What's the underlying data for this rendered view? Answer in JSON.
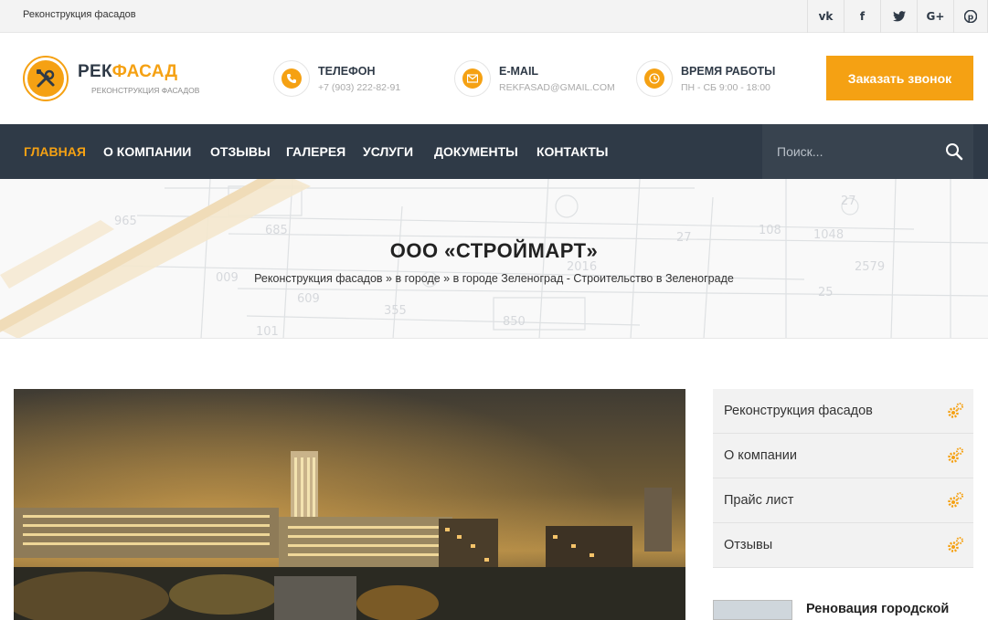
{
  "topbar": {
    "tagline": "Реконструкция фасадов",
    "social": [
      {
        "icon": "vk-icon",
        "glyph": "vk"
      },
      {
        "icon": "facebook-icon",
        "glyph": "f"
      },
      {
        "icon": "twitter-icon",
        "glyph": "t"
      },
      {
        "icon": "google-plus-icon",
        "glyph": "G+"
      },
      {
        "icon": "pinterest-icon",
        "glyph": "P"
      }
    ]
  },
  "header": {
    "logo_part1": "РЕК",
    "logo_part2": "ФАСАД",
    "logo_sub": "РЕКОНСТРУКЦИЯ ФАСАДОВ",
    "phone_title": "ТЕЛЕФОН",
    "phone_value": "+7 (903) 222-82-91",
    "email_title": "E-MAIL",
    "email_value": "REKFASAD@GMAIL.COM",
    "hours_title": "ВРЕМЯ РАБОТЫ",
    "hours_value": "ПН - СБ 9:00 - 18:00",
    "call_button": "Заказать звонок"
  },
  "nav": {
    "items": [
      "ГЛАВНАЯ",
      "О КОМПАНИИ",
      "ОТЗЫВЫ",
      "ГАЛЕРЕЯ",
      "УСЛУГИ",
      "ДОКУМЕНТЫ",
      "КОНТАКТЫ"
    ],
    "search_placeholder": "Поиск..."
  },
  "banner": {
    "title": "ООО «СТРОЙМАРТ»",
    "crumb1": "Реконструкция фасадов",
    "crumb2": "в городе",
    "crumb3": "в городе Зеленоград - Строительство в Зеленограде",
    "sep": " » "
  },
  "sidebar": {
    "items": [
      "Реконструкция фасадов",
      "О компании",
      "Прайс лист",
      "Отзывы"
    ]
  },
  "news": {
    "title": "Реновация городской"
  },
  "colors": {
    "accent": "#f5a113",
    "nav_bg": "#2f3a47"
  }
}
